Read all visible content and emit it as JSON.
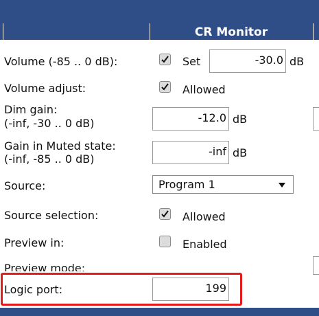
{
  "header": {
    "column_title": "CR Monitor"
  },
  "rows": {
    "volume": {
      "label": "Volume (-85 .. 0 dB):",
      "checkbox_label": "Set",
      "checked": true,
      "value": "-30.0",
      "unit": "dB"
    },
    "volume_adjust": {
      "label": "Volume adjust:",
      "checkbox_label": "Allowed",
      "checked": true
    },
    "dim_gain": {
      "label_line1": "Dim gain:",
      "label_line2": "(-inf, -30 .. 0 dB)",
      "value": "-12.0",
      "unit": "dB"
    },
    "gain_muted": {
      "label_line1": "Gain in Muted state:",
      "label_line2": "(-inf, -85 .. 0 dB)",
      "value": "-inf",
      "unit": "dB"
    },
    "source": {
      "label": "Source:",
      "selected": "Program 1"
    },
    "source_selection": {
      "label": "Source selection:",
      "checkbox_label": "Allowed",
      "checked": true
    },
    "preview_in": {
      "label": "Preview in:",
      "checkbox_label": "Enabled",
      "checked": false
    },
    "preview_mode": {
      "label": "Preview mode:"
    },
    "logic_port": {
      "label": "Logic port:",
      "value": "199"
    }
  },
  "colors": {
    "header_bg": "#2f4d86",
    "highlight": "#e3191c",
    "checkbox_bg": "#dcdcdc"
  },
  "icons": {
    "check": "check-icon",
    "dropdown": "chevron-down-icon"
  }
}
